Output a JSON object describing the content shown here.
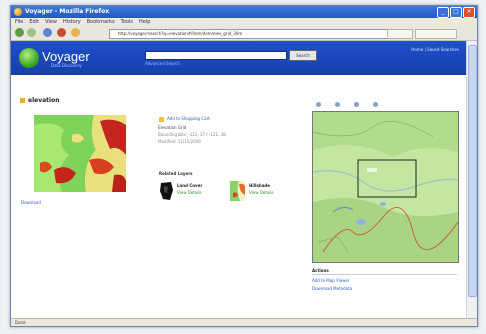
{
  "window": {
    "title": "Voyager - Mozilla Firefox"
  },
  "menu": {
    "items": [
      "File",
      "Edit",
      "View",
      "History",
      "Bookmarks",
      "Tools",
      "Help"
    ]
  },
  "address": {
    "url": "http://voyager/search?q=elevation#/item/dem/elev_grid_30m"
  },
  "header": {
    "logo": "Voyager",
    "subtitle": "Data Discovery",
    "search_button": "Search",
    "search_link": "Advanced Search",
    "links": "Home | Saved Searches"
  },
  "content": {
    "title": "elevation",
    "thumb_link": "Download",
    "meta": [
      "Add to Shopping Cart",
      "Elevation Grid",
      "Bounding Box: -122, 37 / -121, 38",
      "Modified: 11/15/2008"
    ],
    "related_label": "Related Layers",
    "related": [
      {
        "title": "Land Cover",
        "link": "View Details"
      },
      {
        "title": "Hillshade",
        "link": "View Details"
      }
    ]
  },
  "details": {
    "heading": "Actions",
    "items": [
      "Add to Map Viewer",
      "Download Metadata"
    ]
  },
  "status": {
    "text": "Done"
  },
  "colors": {
    "brand": "#1f4fcc",
    "titlebar": "#2356c4",
    "map_bg": "#bde39a"
  },
  "icons": [
    "app-icon",
    "back-icon",
    "forward-icon",
    "reload-icon",
    "stop-icon",
    "home-icon",
    "zoom-in-icon",
    "zoom-out-icon",
    "pan-icon",
    "extent-icon"
  ]
}
